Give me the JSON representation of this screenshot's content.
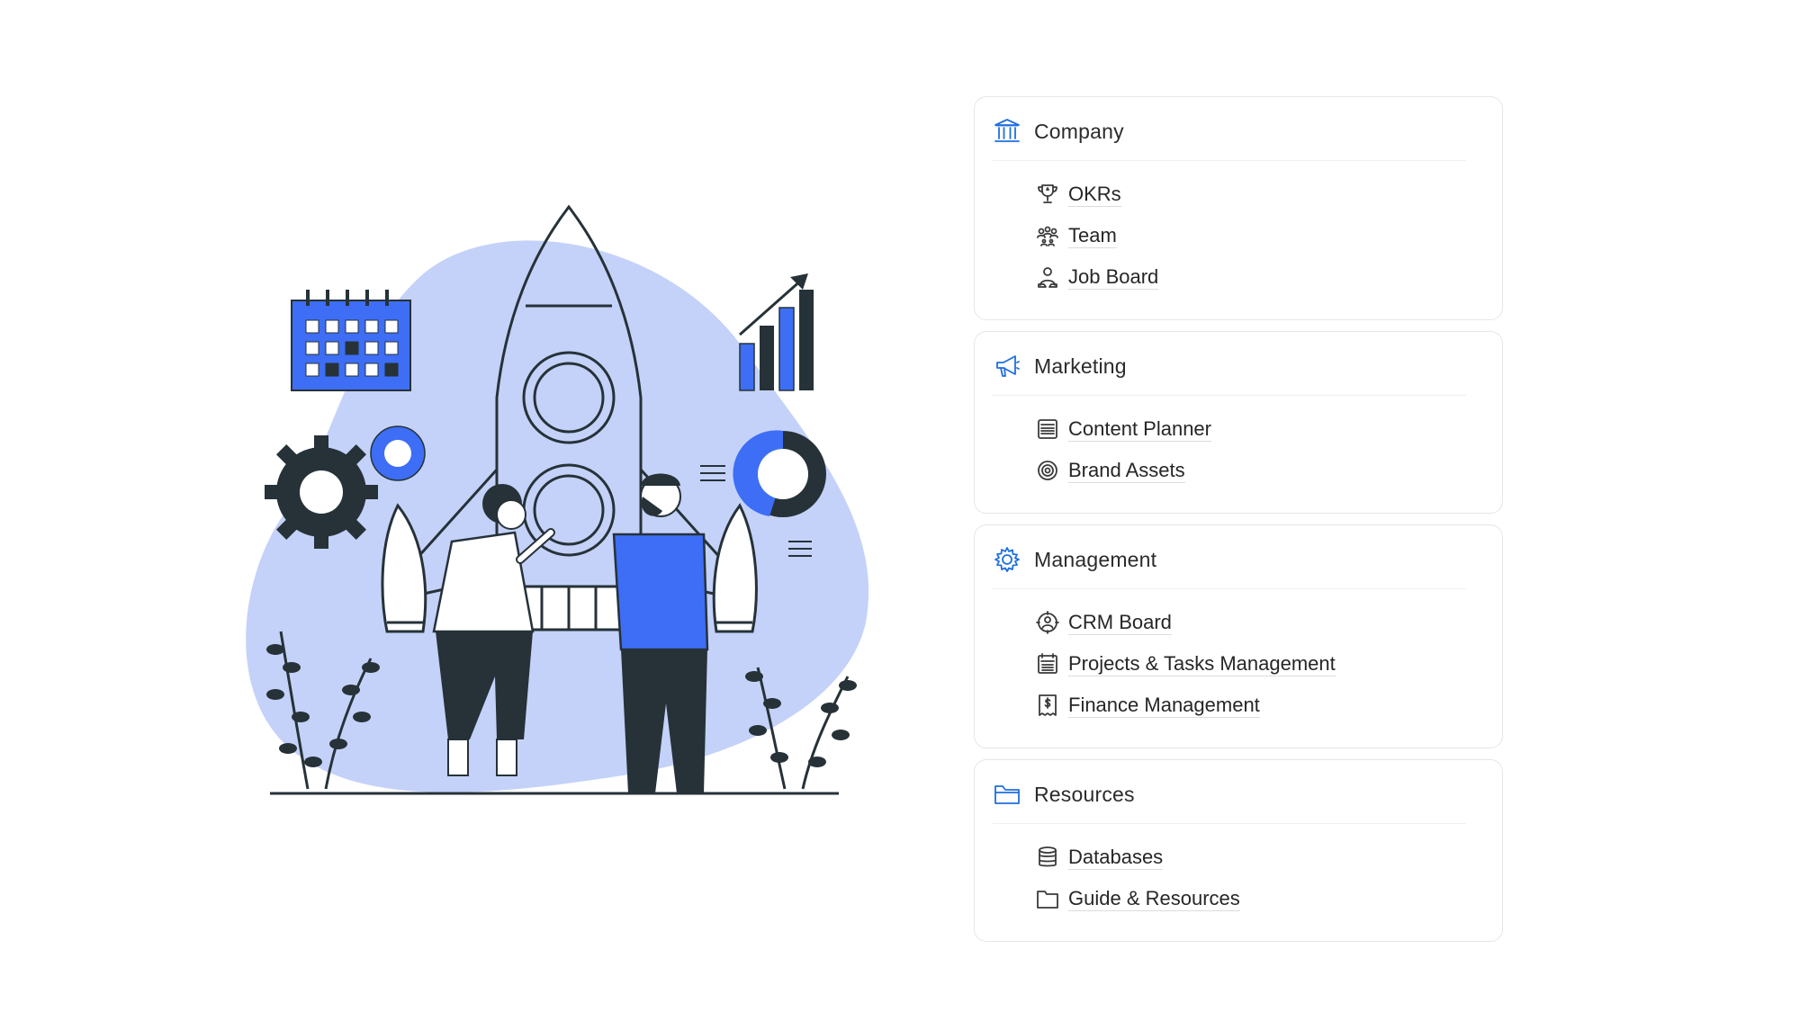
{
  "colors": {
    "accent": "#1f6fde",
    "blob": "#c4d2f9",
    "illustration_blue": "#3d6ef5",
    "dark": "#263238",
    "card_border": "#e6e6e9",
    "text": "#2b2b2b"
  },
  "sections": [
    {
      "title": "Company",
      "icon": "bank-icon",
      "items": [
        {
          "label": "OKRs",
          "icon": "trophy-icon"
        },
        {
          "label": "Team",
          "icon": "team-icon"
        },
        {
          "label": "Job Board",
          "icon": "job-person-icon"
        }
      ]
    },
    {
      "title": "Marketing",
      "icon": "megaphone-icon",
      "items": [
        {
          "label": "Content Planner",
          "icon": "newspaper-icon"
        },
        {
          "label": "Brand Assets",
          "icon": "target-icon"
        }
      ]
    },
    {
      "title": "Management",
      "icon": "gear-icon",
      "items": [
        {
          "label": "CRM Board",
          "icon": "customer-icon"
        },
        {
          "label": "Projects & Tasks Management",
          "icon": "project-calendar-icon"
        },
        {
          "label": "Finance Management",
          "icon": "invoice-icon"
        }
      ]
    },
    {
      "title": "Resources",
      "icon": "folder-open-icon",
      "items": [
        {
          "label": "Databases",
          "icon": "database-icon"
        },
        {
          "label": "Guide & Resources",
          "icon": "folder-icon"
        }
      ]
    }
  ]
}
